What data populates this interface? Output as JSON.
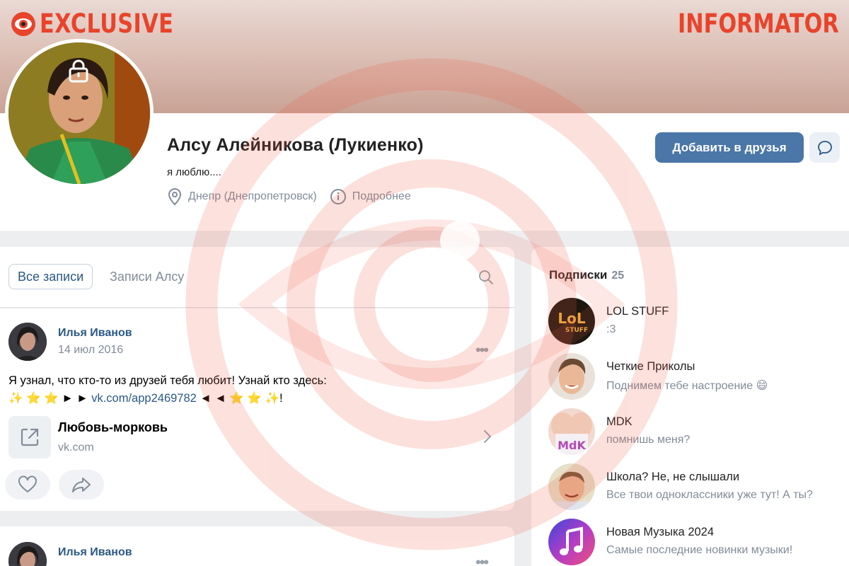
{
  "watermark": {
    "left_brand": "EXCLUSIVE",
    "right_brand": "INFORMATOR",
    "accent": "#e8442b"
  },
  "profile": {
    "name": "Алсу Алейникова (Лукиенко)",
    "status": "я люблю....",
    "city": "Днепр (Днепропетровск)",
    "more_label": "Подробнее",
    "add_friend_label": "Добавить в друзья",
    "private": true
  },
  "feed": {
    "tabs": [
      {
        "label": "Все записи",
        "active": true
      },
      {
        "label": "Записи Алсу",
        "active": false
      }
    ],
    "posts": [
      {
        "author": "Илья Иванов",
        "date": "14 июл 2016",
        "text_line1": "Я узнал, что кто-то из друзей тебя любит! Узнай кто здесь:",
        "text_prefix": "✨ ⭐ ⭐ ► ► ",
        "link": "vk.com/app2469782",
        "text_suffix": " ◄ ◄ ⭐ ⭐ ✨!",
        "attachment": {
          "title": "Любовь-морковь",
          "domain": "vk.com"
        }
      },
      {
        "author": "Илья Иванов"
      }
    ]
  },
  "subscriptions": {
    "title": "Подписки",
    "count": "25",
    "items": [
      {
        "name": "LOL STUFF",
        "desc": ":3",
        "avatar_icon": "lol-stuff-logo"
      },
      {
        "name": "Четкие Приколы",
        "desc": "Поднимем тебе настроение 😄",
        "avatar_icon": "cartoon-face"
      },
      {
        "name": "MDK",
        "desc": "помнишь меня?",
        "avatar_icon": "mdk-logo"
      },
      {
        "name": "Школа? Не, не слышали",
        "desc": "Все твои одноклассники уже тут! А ты?",
        "avatar_icon": "cartoon-boy"
      },
      {
        "name": "Новая Музыка 2024",
        "desc": "Самые последние новинки музыки!",
        "avatar_icon": "music-note"
      }
    ]
  }
}
